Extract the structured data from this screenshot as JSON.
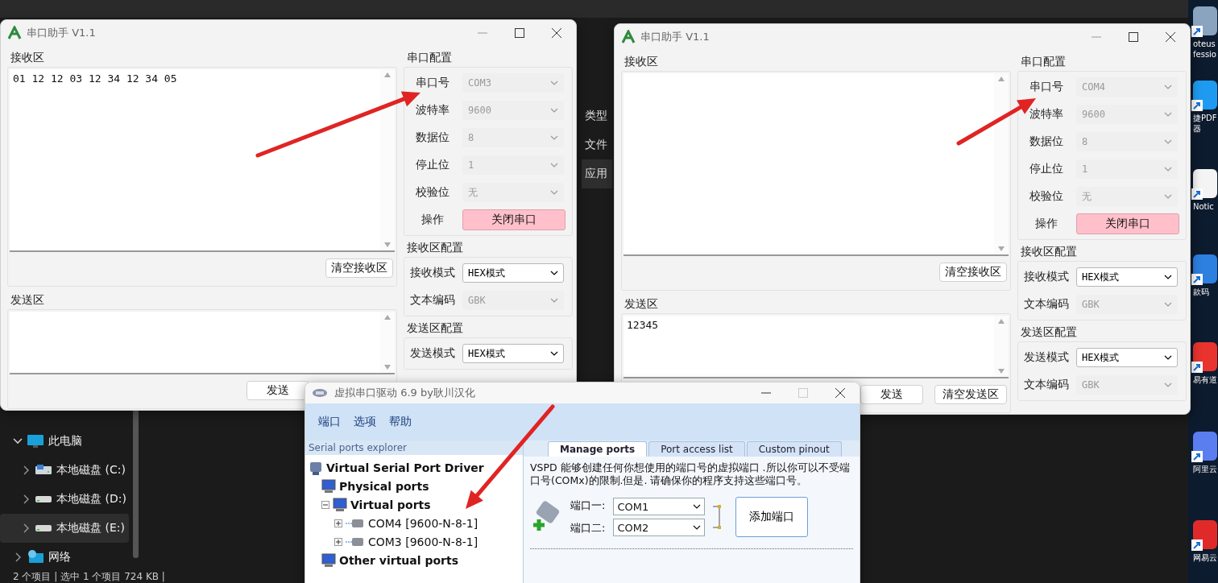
{
  "explorer": {
    "details_rows": [
      {
        "label": "类型",
        "selected": false
      },
      {
        "label": "文件",
        "selected": false
      },
      {
        "label": "应用",
        "selected": true
      }
    ],
    "nav": [
      {
        "label": "此电脑",
        "kind": "computer",
        "expanded": true,
        "selected": false,
        "children": [
          {
            "label": "本地磁盘 (C:)",
            "kind": "system-drive",
            "expanded": false,
            "selected": false
          },
          {
            "label": "本地磁盘 (D:)",
            "kind": "drive",
            "expanded": false,
            "selected": false
          },
          {
            "label": "本地磁盘 (E:)",
            "kind": "drive",
            "expanded": false,
            "selected": true
          }
        ]
      },
      {
        "label": "网络",
        "kind": "network",
        "expanded": false,
        "selected": false
      }
    ],
    "status_bar": "2 个项目 | 选中 1 个项目 724 KB |"
  },
  "serial_windows": [
    {
      "title": "串口助手 V1.1",
      "receive_label": "接收区",
      "receive_text": "01 12 12 03 12 34 12 34 05",
      "clear_receive": "清空接收区",
      "send_label": "发送区",
      "buttons": [
        "发送"
      ],
      "groups": [
        {
          "title": "串口配置",
          "rows": [
            {
              "label": "串口号",
              "kind": "select",
              "value": "COM3",
              "disabled": true
            },
            {
              "label": "波特率",
              "kind": "select",
              "value": "9600",
              "disabled": true
            },
            {
              "label": "数据位",
              "kind": "select",
              "value": "8",
              "disabled": true
            },
            {
              "label": "停止位",
              "kind": "select",
              "value": "1",
              "disabled": true
            },
            {
              "label": "校验位",
              "kind": "select",
              "value": "无",
              "disabled": true
            },
            {
              "label": "操作",
              "kind": "button",
              "value": "关闭串口"
            }
          ]
        },
        {
          "title": "接收区配置",
          "rows": [
            {
              "label": "接收模式",
              "kind": "select",
              "value": "HEX模式",
              "disabled": false
            },
            {
              "label": "文本编码",
              "kind": "select",
              "value": "GBK",
              "disabled": true
            }
          ]
        },
        {
          "title": "发送区配置",
          "rows": [
            {
              "label": "发送模式",
              "kind": "select",
              "value": "HEX模式",
              "disabled": false
            }
          ]
        }
      ]
    },
    {
      "title": "串口助手 V1.1",
      "receive_label": "接收区",
      "clear_receive": "清空接收区",
      "send_label": "发送区",
      "send_text": "12345",
      "buttons": [
        "发送",
        "清空发送区"
      ],
      "groups": [
        {
          "title": "串口配置",
          "rows": [
            {
              "label": "串口号",
              "kind": "select",
              "value": "COM4",
              "disabled": true
            },
            {
              "label": "波特率",
              "kind": "select",
              "value": "9600",
              "disabled": true
            },
            {
              "label": "数据位",
              "kind": "select",
              "value": "8",
              "disabled": true
            },
            {
              "label": "停止位",
              "kind": "select",
              "value": "1",
              "disabled": true
            },
            {
              "label": "校验位",
              "kind": "select",
              "value": "无",
              "disabled": true
            },
            {
              "label": "操作",
              "kind": "button",
              "value": "关闭串口"
            }
          ]
        },
        {
          "title": "接收区配置",
          "rows": [
            {
              "label": "接收模式",
              "kind": "select",
              "value": "HEX模式",
              "disabled": false
            },
            {
              "label": "文本编码",
              "kind": "select",
              "value": "GBK",
              "disabled": true
            }
          ]
        },
        {
          "title": "发送区配置",
          "rows": [
            {
              "label": "发送模式",
              "kind": "select",
              "value": "HEX模式",
              "disabled": false
            },
            {
              "label": "文本编码",
              "kind": "select",
              "value": "GBK",
              "disabled": true
            }
          ]
        }
      ]
    }
  ],
  "vspd": {
    "title": "虚拟串口驱动 6.9 by耿川汉化",
    "menu": [
      "端口",
      "选项",
      "帮助"
    ],
    "explorer_title": "Serial ports explorer",
    "tree": [
      {
        "label": "Virtual Serial Port Driver",
        "kind": "root",
        "children": [
          {
            "label": "Physical ports",
            "kind": "category"
          },
          {
            "label": "Virtual ports",
            "kind": "category",
            "expanded": true,
            "children": [
              {
                "label": "COM4 [9600-N-8-1]",
                "kind": "port",
                "expanded": false
              },
              {
                "label": "COM3 [9600-N-8-1]",
                "kind": "port",
                "expanded": false
              }
            ]
          },
          {
            "label": "Other virtual ports",
            "kind": "category"
          }
        ]
      }
    ],
    "tabs": [
      {
        "label": "Manage ports",
        "selected": true
      },
      {
        "label": "Port access list",
        "selected": false
      },
      {
        "label": "Custom pinout",
        "selected": false
      }
    ],
    "description": "VSPD 能够创建任何你想使用的端口号的虚拟端口 .所以你可以不受端口号(COMx)的限制.但是. 请确保你的程序支持这些端口号。",
    "pair": [
      {
        "label": "端口一:",
        "value": "COM1"
      },
      {
        "label": "端口二:",
        "value": "COM2"
      }
    ],
    "add_button": "添加端口"
  },
  "desktop_icons": [
    {
      "label_lines": [
        "oteus",
        "fessio"
      ],
      "color": "#8aa4c0"
    },
    {
      "label_lines": [
        "捷PDF",
        "器"
      ],
      "color": "#1e9bf0"
    },
    {
      "label_lines": [
        "Notic"
      ],
      "color": "#f4f4f4"
    },
    {
      "label_lines": [
        "款码"
      ],
      "color": "#2d7fe0"
    },
    {
      "label_lines": [
        "易有道"
      ],
      "color": "#e8332f"
    },
    {
      "label_lines": [
        "阿里云"
      ],
      "color": "#5a7df0"
    },
    {
      "label_lines": [
        "网易云"
      ],
      "color": "#e02a2a"
    }
  ]
}
